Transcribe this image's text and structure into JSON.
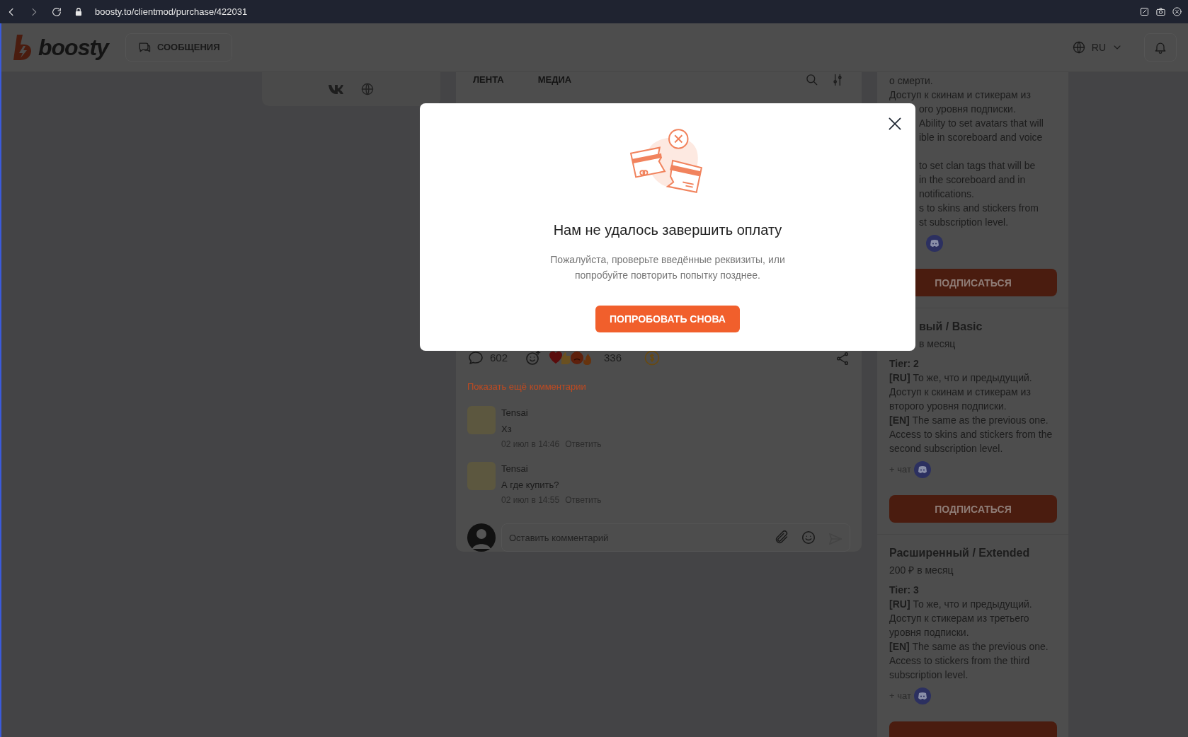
{
  "browser": {
    "url": "boosty.to/clientmod/purchase/422031"
  },
  "header": {
    "logo": "boosty",
    "messages_button": "СООБЩЕНИЯ",
    "language": "RU"
  },
  "feed_tabs": [
    "ЛЕНТА",
    "МЕДИА"
  ],
  "post": {
    "comments_count": "602",
    "reactions_count": "336",
    "show_more": "Показать ещё комментарии",
    "comments": [
      {
        "author": "Tensai",
        "text": "Хз",
        "time": "02 июл в 14:46",
        "reply": "Ответить"
      },
      {
        "author": "Tensai",
        "text": "А где купить?",
        "time": "02 июл в 14:55",
        "reply": "Ответить"
      }
    ],
    "comment_placeholder": "Оставить комментарий"
  },
  "partial_tier": {
    "visible_lines": [
      "о смерти.",
      "Доступ к скинам и стикерам из"
    ],
    "covered_paragraphs": [
      [
        "ого уровня подписки.",
        "Ability to set avatars that will",
        "ible in scoreboard and voice"
      ],
      [
        "to set clan tags that will be",
        "in the scoreboard and in",
        "notifications.",
        "s to skins and stickers from",
        "st subscription level."
      ]
    ],
    "button": "ПОДПИСАТЬСЯ"
  },
  "tiers": [
    {
      "title": "вый / Basic",
      "title_covered": true,
      "price": "в месяц",
      "tier": "Tier: 2",
      "description": [
        "**[RU]** То же, что и предыдущий. Доступ к скинам и стикерам из второго уровня подписки.",
        "**[EN]** The same as the previous one. Access to skins and stickers from the second subscription level."
      ],
      "chat": "+ чат",
      "button": "ПОДПИСАТЬСЯ"
    },
    {
      "title": "Расширенный / Extended",
      "title_covered": false,
      "price": "200 ₽ в месяц",
      "tier": "Tier: 3",
      "description": [
        "**[RU]** То же, что и предыдущий. Доступ к стикерам из третьего уровня подписки.",
        "**[EN]** The same as the previous one. Access to stickers from the third subscription level."
      ],
      "chat": "+ чат"
    }
  ],
  "modal": {
    "title": "Нам не удалось завершить оплату",
    "message": "Пожалуйста, проверьте введённые реквизиты, или попробуйте повторить попытку позднее.",
    "button": "ПОПРОБОВАТЬ СНОВА"
  }
}
